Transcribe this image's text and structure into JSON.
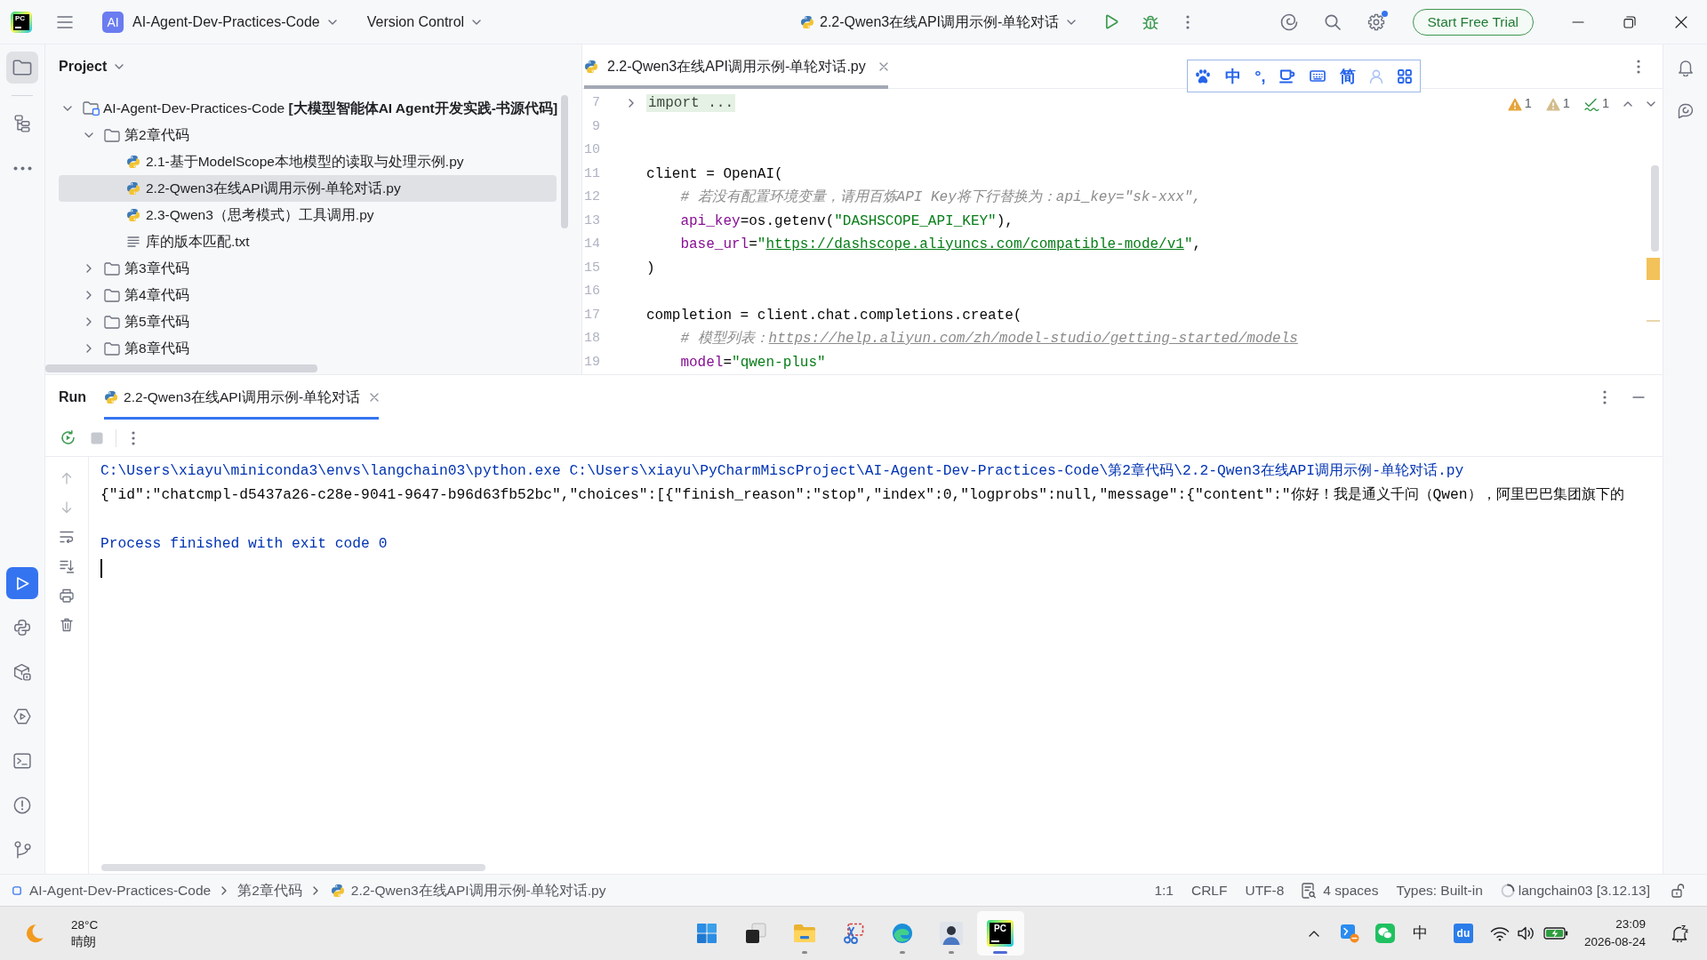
{
  "title_bar": {
    "logo_text": "PC",
    "project_badge": "AI",
    "project": "AI-Agent-Dev-Practices-Code",
    "vcs": "Version Control",
    "run_config": "2.2-Qwen3在线API调用示例-单轮对话",
    "trial_button": "Start Free Trial"
  },
  "left_toolbar": {
    "top": [
      {
        "kind": "project",
        "selected": true,
        "focused": false
      },
      {
        "kind": "structure",
        "selected": false
      },
      {
        "kind": "more",
        "selected": false
      }
    ],
    "bottom": [
      {
        "kind": "run",
        "selected": true,
        "focused": true
      },
      {
        "kind": "python-console",
        "selected": false
      },
      {
        "kind": "packages",
        "selected": false
      },
      {
        "kind": "services",
        "selected": false
      },
      {
        "kind": "terminal",
        "selected": false
      },
      {
        "kind": "problems",
        "selected": false
      },
      {
        "kind": "git",
        "selected": false
      }
    ]
  },
  "project_panel": {
    "title": "Project",
    "tree": [
      {
        "kind": "module",
        "label": "AI-Agent-Dev-Practices-Code **[大模型智能体AI Agent开发实践-书源代码]**",
        "expanded": true,
        "selected": false,
        "children": [
          {
            "kind": "folder",
            "label": "第2章代码",
            "expanded": true,
            "selected": false,
            "children": [
              {
                "kind": "python",
                "label": "2.1-基于ModelScope本地模型的读取与处理示例.py",
                "selected": false
              },
              {
                "kind": "python",
                "label": "2.2-Qwen3在线API调用示例-单轮对话.py",
                "selected": true
              },
              {
                "kind": "python",
                "label": "2.3-Qwen3（思考模式）工具调用.py",
                "selected": false
              },
              {
                "kind": "text",
                "label": "库的版本匹配.txt",
                "selected": false
              }
            ]
          },
          {
            "kind": "folder",
            "label": "第3章代码",
            "expanded": false,
            "selected": false
          },
          {
            "kind": "folder",
            "label": "第4章代码",
            "expanded": false,
            "selected": false
          },
          {
            "kind": "folder",
            "label": "第5章代码",
            "expanded": false,
            "selected": false
          },
          {
            "kind": "folder",
            "label": "第8章代码",
            "expanded": false,
            "selected": false
          }
        ]
      }
    ]
  },
  "editor": {
    "tabs": [
      {
        "label": "2.2-Qwen3在线API调用示例-单轮对话.py",
        "selected": true
      }
    ],
    "inspections": [
      {
        "kind": "warning",
        "count": "1"
      },
      {
        "kind": "weak-warning",
        "count": "1"
      },
      {
        "kind": "typo",
        "count": "1"
      }
    ],
    "lines": [
      {
        "number": "7",
        "folded": true,
        "tokens": [
          {
            "kind": "folded",
            "text": "import ..."
          }
        ]
      },
      {
        "number": "9",
        "folded": false
      },
      {
        "number": "10",
        "folded": false
      },
      {
        "number": "11",
        "folded": false,
        "tokens": [
          {
            "kind": "plain",
            "text": "client = OpenAI("
          }
        ]
      },
      {
        "number": "12",
        "folded": false,
        "tokens": [
          {
            "kind": "comment",
            "text": "    # 若没有配置环境变量，请用百炼API Key将下行替换为：api_key=\"sk-xxx\","
          }
        ]
      },
      {
        "number": "13",
        "folded": false,
        "tokens": [
          {
            "kind": "param",
            "text": "    api_key"
          },
          {
            "kind": "plain",
            "text": "=os.getenv("
          },
          {
            "kind": "string",
            "text": "\"DASHSCOPE_API_KEY\""
          },
          {
            "kind": "plain",
            "text": "),"
          }
        ]
      },
      {
        "number": "14",
        "folded": false,
        "tokens": [
          {
            "kind": "param",
            "text": "    base_url"
          },
          {
            "kind": "plain",
            "text": "="
          },
          {
            "kind": "string",
            "text": "\""
          },
          {
            "kind": "url",
            "text": "https://dashscope.aliyuncs.com/compatible-mode/v1"
          },
          {
            "kind": "string",
            "text": "\""
          },
          {
            "kind": "plain",
            "text": ","
          }
        ]
      },
      {
        "number": "15",
        "folded": false,
        "tokens": [
          {
            "kind": "plain",
            "text": ")"
          }
        ]
      },
      {
        "number": "16",
        "folded": false
      },
      {
        "number": "17",
        "folded": false,
        "tokens": [
          {
            "kind": "plain",
            "text": "completion = client.chat.completions.create("
          }
        ]
      },
      {
        "number": "18",
        "folded": false,
        "tokens": [
          {
            "kind": "comment",
            "text": "    # 模型列表："
          },
          {
            "kind": "comment-url",
            "text": "https://help.aliyun.com/zh/model-studio/getting-started/models"
          }
        ]
      },
      {
        "number": "19",
        "folded": false,
        "tokens": [
          {
            "kind": "param",
            "text": "    model"
          },
          {
            "kind": "plain",
            "text": "="
          },
          {
            "kind": "string",
            "text": "\"qwen-plus\""
          }
        ]
      }
    ]
  },
  "ime_toolbar": {
    "mode": "中",
    "punctuation": "°,",
    "script": "简"
  },
  "run_panel": {
    "title": "Run",
    "tabs": [
      {
        "label": "2.2-Qwen3在线API调用示例-单轮对话",
        "selected": true
      }
    ],
    "console": [
      {
        "kind": "system",
        "text": "C:\\Users\\xiayu\\miniconda3\\envs\\langchain03\\python.exe C:\\Users\\xiayu\\PyCharmMiscProject\\AI-Agent-Dev-Practices-Code\\第2章代码\\2.2-Qwen3在线API调用示例-单轮对话.py"
      },
      {
        "kind": "output",
        "text": "{\"id\":\"chatcmpl-d5437a26-c28e-9041-9647-b96d63fb52bc\",\"choices\":[{\"finish_reason\":\"stop\",\"index\":0,\"logprobs\":null,\"message\":{\"content\":\"你好！我是通义千问（Qwen），阿里巴巴集团旗下的"
      },
      {
        "kind": "blank"
      },
      {
        "kind": "system",
        "text": "Process finished with exit code 0"
      }
    ]
  },
  "status_bar": {
    "breadcrumbs": [
      {
        "kind": "module",
        "label": "AI-Agent-Dev-Practices-Code"
      },
      {
        "kind": "folder",
        "label": "第2章代码"
      },
      {
        "kind": "python",
        "label": "2.2-Qwen3在线API调用示例-单轮对话.py"
      }
    ],
    "items": [
      {
        "kind": "text",
        "label": "1:1"
      },
      {
        "kind": "text",
        "label": "CRLF"
      },
      {
        "kind": "text",
        "label": "UTF-8"
      },
      {
        "kind": "indent",
        "label": "4 spaces"
      },
      {
        "kind": "text",
        "label": "Types: Built-in"
      },
      {
        "kind": "interpreter",
        "label": "langchain03 [3.12.13]"
      }
    ]
  },
  "taskbar": {
    "weather": {
      "temperature": "28°C",
      "condition": "晴朗"
    },
    "apps": [
      {
        "kind": "start",
        "running": false,
        "selected": false
      },
      {
        "kind": "task-view",
        "running": false,
        "selected": false
      },
      {
        "kind": "explorer",
        "running": true,
        "selected": false
      },
      {
        "kind": "snipping",
        "running": false,
        "selected": false
      },
      {
        "kind": "browser",
        "running": true,
        "selected": false
      },
      {
        "kind": "avatar",
        "running": true,
        "selected": false
      },
      {
        "kind": "ide",
        "running": true,
        "selected": true,
        "label": "PC"
      }
    ],
    "tray": {
      "ime": "中",
      "baidu": "du"
    },
    "clock": {
      "time": "23:09",
      "date": "2026-08-24"
    }
  }
}
